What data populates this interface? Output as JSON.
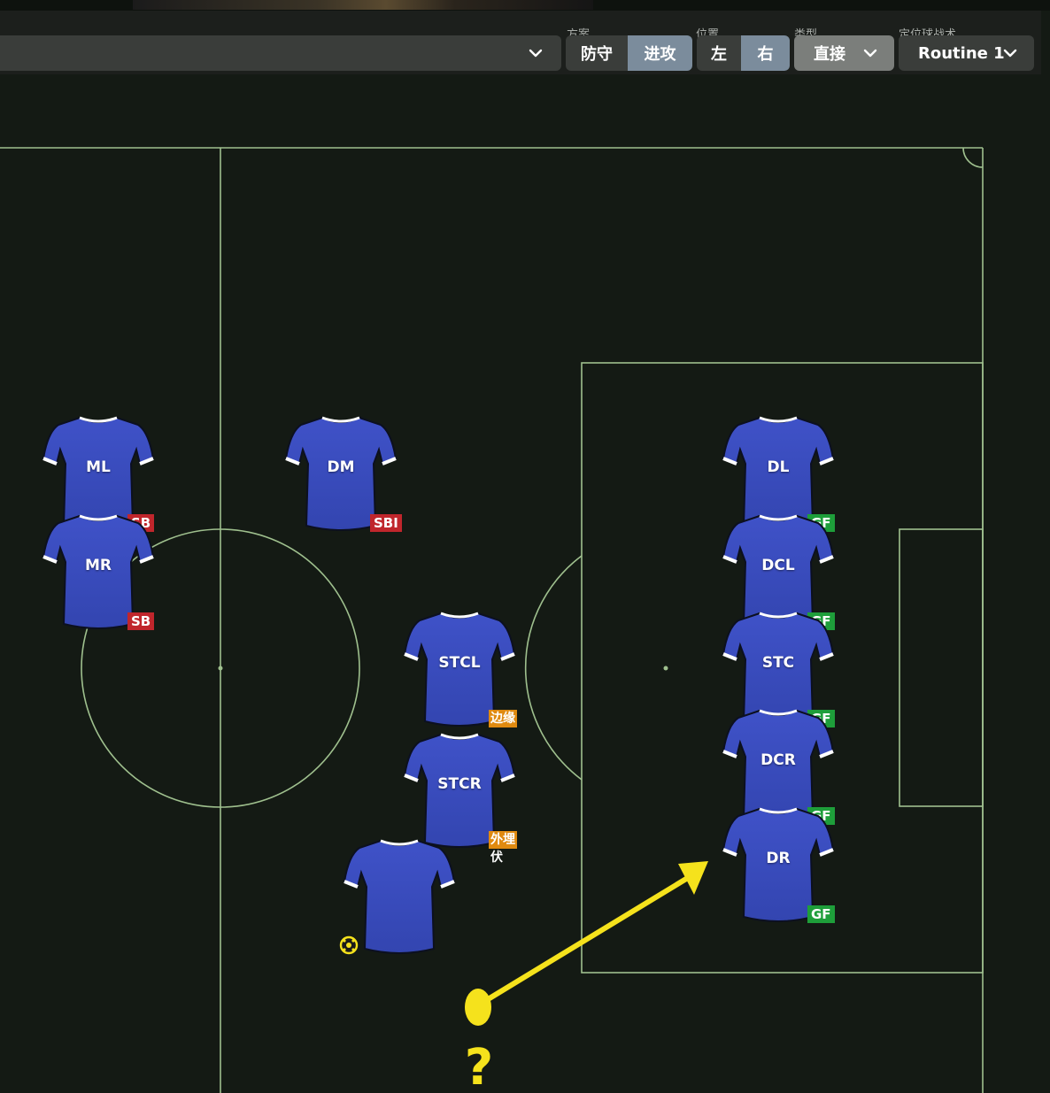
{
  "toolbar": {
    "main_dropdown_value": "",
    "groups": {
      "plan_label": "方案",
      "position_label": "位置",
      "type_label": "类型",
      "routine_label": "定位球战术"
    },
    "plan_options": [
      {
        "label": "防守",
        "active": false
      },
      {
        "label": "进攻",
        "active": true
      }
    ],
    "side_options": [
      {
        "label": "左",
        "active": false
      },
      {
        "label": "右",
        "active": true
      }
    ],
    "type_value": "直接",
    "routine_value": "Routine 1"
  },
  "players": [
    {
      "id": "ML",
      "label": "ML",
      "role": "SB",
      "role_color": "red"
    },
    {
      "id": "MR",
      "label": "MR",
      "role": "SB",
      "role_color": "red"
    },
    {
      "id": "DM",
      "label": "DM",
      "role": "SBI",
      "role_color": "red"
    },
    {
      "id": "STCL",
      "label": "STCL",
      "role": "边缘",
      "role_color": "orange"
    },
    {
      "id": "STCR",
      "label": "STCR",
      "role": "外埋伏",
      "role_color": "orange"
    },
    {
      "id": "TAKER",
      "label": "",
      "role": "",
      "role_color": ""
    },
    {
      "id": "DL",
      "label": "DL",
      "role": "GF",
      "role_color": "green"
    },
    {
      "id": "DCL",
      "label": "DCL",
      "role": "GF",
      "role_color": "green"
    },
    {
      "id": "STC",
      "label": "STC",
      "role": "GF",
      "role_color": "green"
    },
    {
      "id": "DCR",
      "label": "DCR",
      "role": "GF",
      "role_color": "green"
    },
    {
      "id": "DR",
      "label": "DR",
      "role": "GF",
      "role_color": "green"
    }
  ],
  "free_kick_marker": "?",
  "colors": {
    "pitch_bg": "#141a14",
    "pitch_lines": "#9fc08e",
    "shirt": "#3f52c8",
    "arrow": "#f5e21c",
    "active_button": "#7b8c9c",
    "role_red": "#c0262c",
    "role_green": "#1e9e3a",
    "role_orange": "#e08a10"
  }
}
